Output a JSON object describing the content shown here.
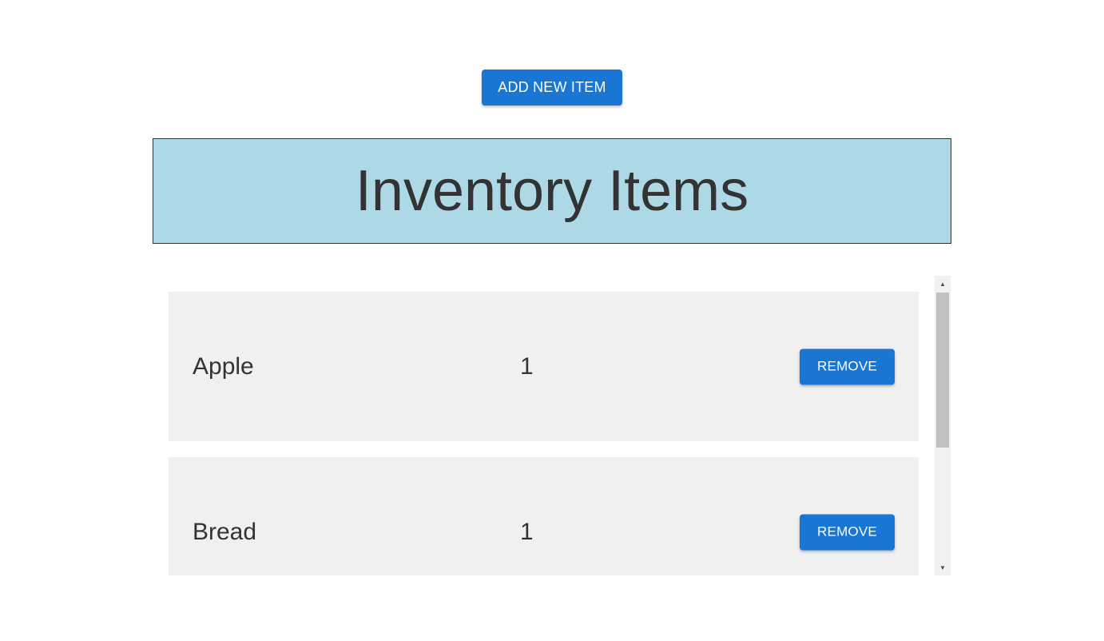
{
  "toolbar": {
    "add_label": "ADD NEW ITEM"
  },
  "header": {
    "title": "Inventory Items"
  },
  "items": [
    {
      "name": "Apple",
      "quantity": "1",
      "remove_label": "REMOVE"
    },
    {
      "name": "Bread",
      "quantity": "1",
      "remove_label": "REMOVE"
    }
  ],
  "scrollbar": {
    "up_icon": "▲",
    "down_icon": "▼"
  },
  "colors": {
    "accent": "#1976d2",
    "header_bg": "#add8e6",
    "card_bg": "#f0f0f0",
    "text": "#333333"
  }
}
